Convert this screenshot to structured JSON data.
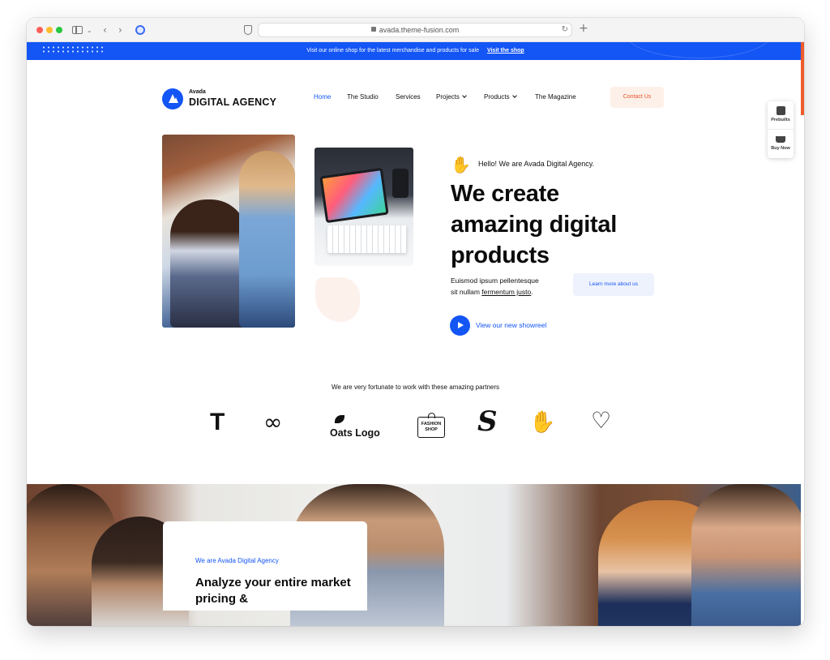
{
  "browser": {
    "url": "avada.theme-fusion.com",
    "new_tab": "+"
  },
  "topbar": {
    "message": "Visit our online shop for the latest merchandise and products for sale",
    "link": "Visit the shop",
    "color": "#1355f5"
  },
  "logo": {
    "small": "Avada",
    "main": "DIGITAL AGENCY"
  },
  "nav": {
    "items": [
      "Home",
      "The Studio",
      "Services",
      "Projects",
      "Products",
      "The Magazine"
    ],
    "active": "Home",
    "contact": "Contact Us"
  },
  "widget": {
    "prebuilts": "Prebuilts",
    "buy_now": "Buy Now"
  },
  "hero": {
    "greeting": "Hello! We are Avada Digital Agency.",
    "headline_lines": [
      "We create",
      "amazing digital",
      "products"
    ],
    "lead_line1": "Euismod ipsum pellentesque",
    "lead_line2_start": "sit nullam ",
    "lead_link": "fermentum justo",
    "lead_end": ".",
    "learn_more": "Learn more about us",
    "showreel": "View our new showreel",
    "wave_icon": "waving-hand-icon"
  },
  "partners": {
    "title": "We are very fortunate to work with these amazing partners",
    "oats": "Oats Logo",
    "fashion_line1": "FASHION",
    "fashion_line2": "SHOP"
  },
  "section2": {
    "kicker": "We are Avada Digital Agency",
    "title": "Analyze your entire market pricing &"
  },
  "colors": {
    "brand_blue": "#1355f5",
    "accent_orange": "#e4562a"
  }
}
